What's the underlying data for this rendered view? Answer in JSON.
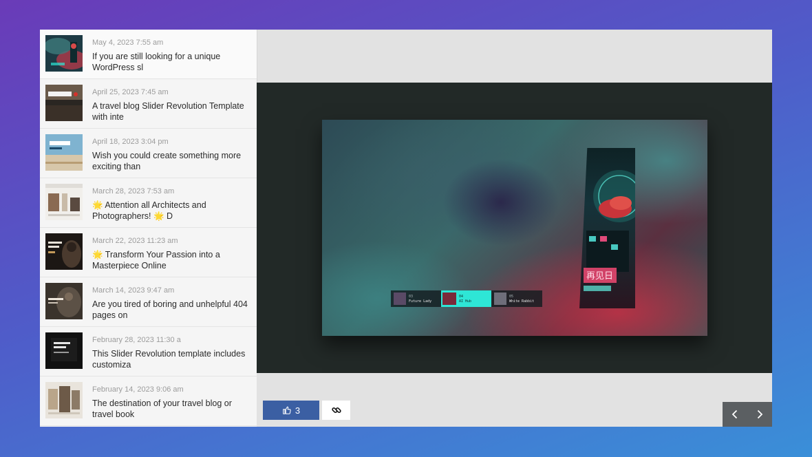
{
  "posts": [
    {
      "date": "May 4, 2023 7:55 am",
      "title": "If you are still looking for a unique WordPress sl"
    },
    {
      "date": "April 25, 2023 7:45 am",
      "title": "A travel blog Slider Revolution Template with inte"
    },
    {
      "date": "April 18, 2023 3:04 pm",
      "title": "Wish you could create something more exciting than"
    },
    {
      "date": "March 28, 2023 7:53 am",
      "title": "🌟 Attention all Architects and Photographers! 🌟 D"
    },
    {
      "date": "March 22, 2023 11:23 am",
      "title": "🌟 Transform Your Passion into a Masterpiece Online"
    },
    {
      "date": "March 14, 2023 9:47 am",
      "title": "Are you tired of boring and unhelpful 404 pages on"
    },
    {
      "date": "February 28, 2023 11:30 a",
      "title": "This Slider Revolution template includes customiza"
    },
    {
      "date": "February 14, 2023 9:06 am",
      "title": "The destination of your travel blog or travel book"
    }
  ],
  "slide": {
    "poster_sign": "再见日",
    "strip": [
      {
        "num": "03",
        "label": "Future Lady"
      },
      {
        "num": "04",
        "label": "AI Hub"
      },
      {
        "num": "05",
        "label": "White Rabbit"
      }
    ]
  },
  "actions": {
    "like_count": "3",
    "like_icon": "thumbs-up-icon",
    "link_icon": "link-icon",
    "prev_icon": "chevron-left-icon",
    "next_icon": "chevron-right-icon"
  },
  "colors": {
    "like_button": "#3b5fa3",
    "nav_background": "#5b5f62",
    "viewer_background": "#222927",
    "strip_active": "#2ee6d6"
  }
}
